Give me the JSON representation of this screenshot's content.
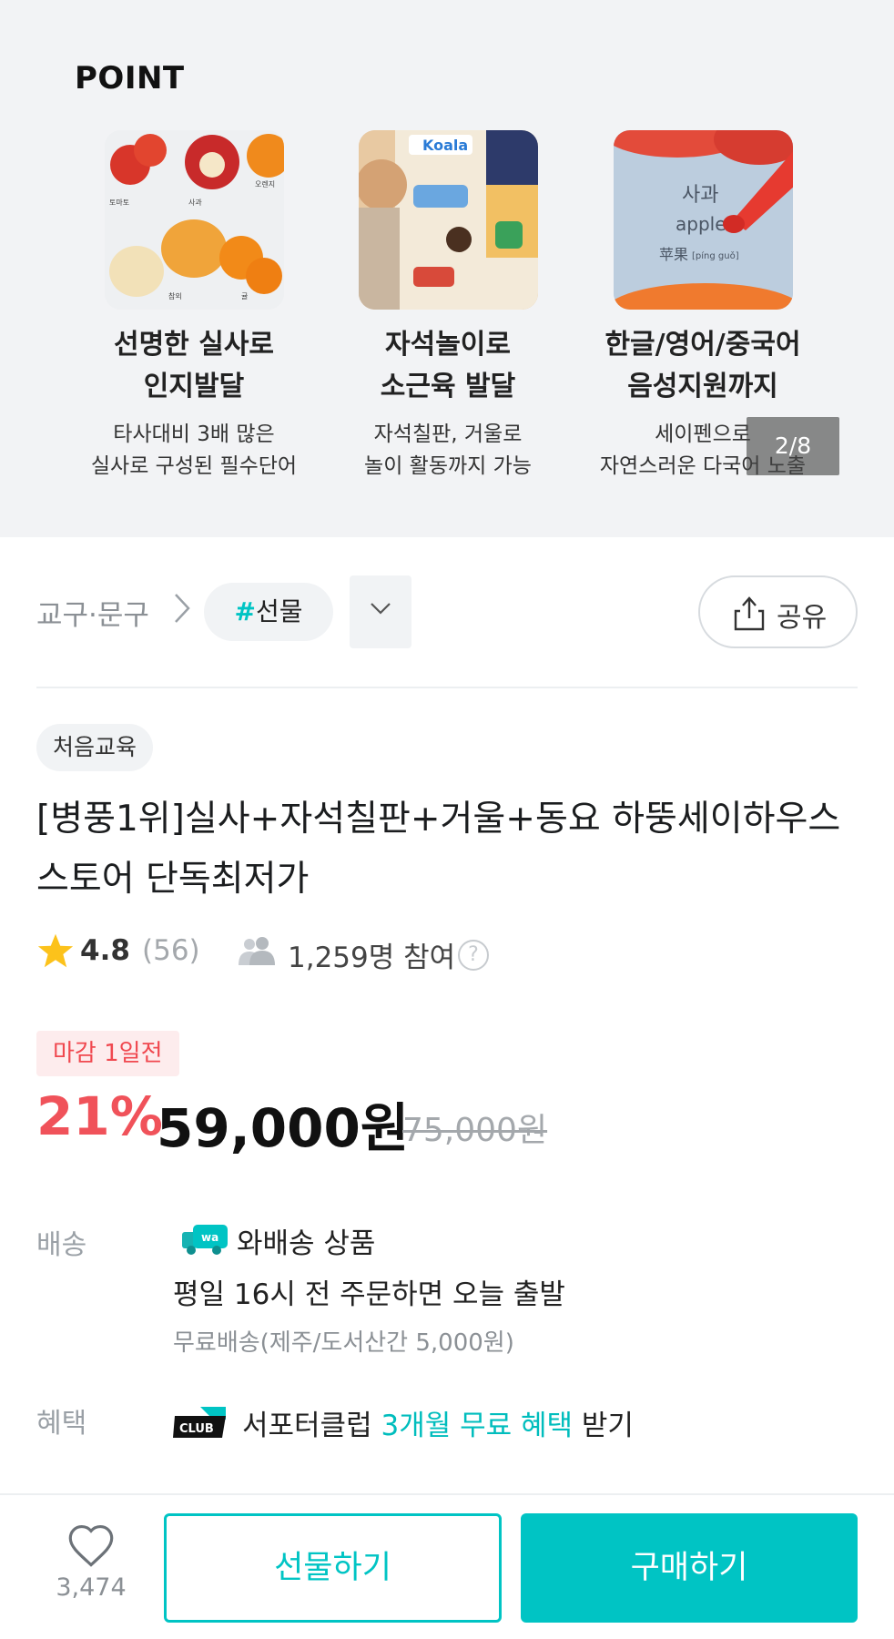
{
  "point": {
    "title": "POINT",
    "pager": "2/8",
    "features": [
      {
        "title": "선명한 실사로\n인지발달",
        "desc": "타사대비 3배 많은\n실사로 구성된 필수단어",
        "image_icon": "fruit-photo"
      },
      {
        "title": "자석놀이로\n소근육 발달",
        "desc": "자석칠판, 거울로\n놀이 활동까지 가능",
        "image_icon": "magnet-board-photo"
      },
      {
        "title": "한글/영어/중국어\n음성지원까지",
        "desc": "세이펜으로\n자연스러운 다국어 노출",
        "image_icon": "apple-pen-photo"
      }
    ],
    "image_text": {
      "koala": "Koala",
      "apple_ko": "사과",
      "apple_en": "apple",
      "apple_zh": "苹果",
      "apple_pinyin": "[píng guǒ]",
      "fruit_labels": [
        "토마토",
        "사과",
        "오렌지",
        "참외",
        "귤"
      ]
    }
  },
  "breadcrumb": {
    "category": "교구·문구",
    "tag_hash": "#",
    "tag": "선물",
    "share_label": "공유"
  },
  "product": {
    "brand": "처음교육",
    "title": "[병풍1위]실사+자석칠판+거울+동요 하뚱세이하우스 스토어 단독최저가",
    "rating": "4.8",
    "review_count": "(56)",
    "participants": "1,259명 참여",
    "help": "?",
    "deadline": "마감 1일전",
    "discount": "21%",
    "price": "59,000원",
    "original_price": "75,000원"
  },
  "shipping": {
    "label": "배송",
    "wa_badge": "wa",
    "type": "와배송 상품",
    "time": "평일 16시 전 주문하면 오늘 출발",
    "fee": "무료배송(제주/도서산간 5,000원)"
  },
  "benefit": {
    "label": "혜택",
    "club_badge": "CLUB",
    "text_prefix": "서포터클럽 ",
    "text_accent": "3개월 무료 혜택",
    "text_suffix": " 받기"
  },
  "bottom_bar": {
    "like_count": "3,474",
    "gift_label": "선물하기",
    "buy_label": "구매하기"
  },
  "colors": {
    "accent": "#00c4c4",
    "discount": "#f0525a",
    "deadline_bg": "#fdeced"
  }
}
